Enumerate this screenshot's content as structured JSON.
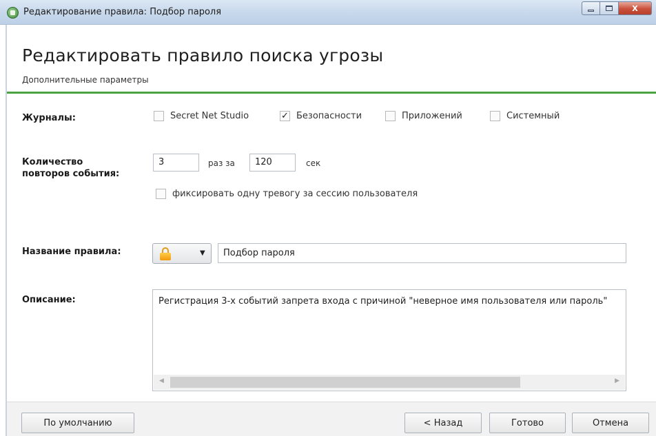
{
  "window": {
    "title": "Редактирование правила: Подбор пароля",
    "controls": {
      "minimize": "minimize",
      "maximize": "maximize",
      "close": "X"
    }
  },
  "header": {
    "title": "Редактировать правило поиска угрозы",
    "subtitle": "Дополнительные параметры"
  },
  "journals": {
    "label": "Журналы:",
    "options": [
      {
        "label": "Secret Net Studio",
        "checked": false
      },
      {
        "label": "Безопасности",
        "checked": true
      },
      {
        "label": "Приложений",
        "checked": false
      },
      {
        "label": "Системный",
        "checked": false
      }
    ]
  },
  "repeat": {
    "label_line1": "Количество",
    "label_line2": "повторов события:",
    "count": "3",
    "times_text": "раз за",
    "seconds": "120",
    "unit": "сек",
    "one_alert_label": "фиксировать одну тревогу за сессию пользователя",
    "one_alert_checked": false
  },
  "rule_name": {
    "label": "Название правила:",
    "icon": "lock-icon",
    "dropdown_arrow": "▼",
    "value": "Подбор пароля"
  },
  "description": {
    "label": "Описание:",
    "value": "Регистрация 3-х событий запрета входа с причиной \"неверное имя пользователя или пароль\"",
    "scroll_left": "◀",
    "scroll_right": "▶"
  },
  "footer": {
    "default_button": "По умолчанию",
    "back_button": "< Назад",
    "done_button": "Готово",
    "cancel_button": "Отмена"
  },
  "colors": {
    "accent_line": "#4aa240",
    "lock": "#f29a10"
  }
}
